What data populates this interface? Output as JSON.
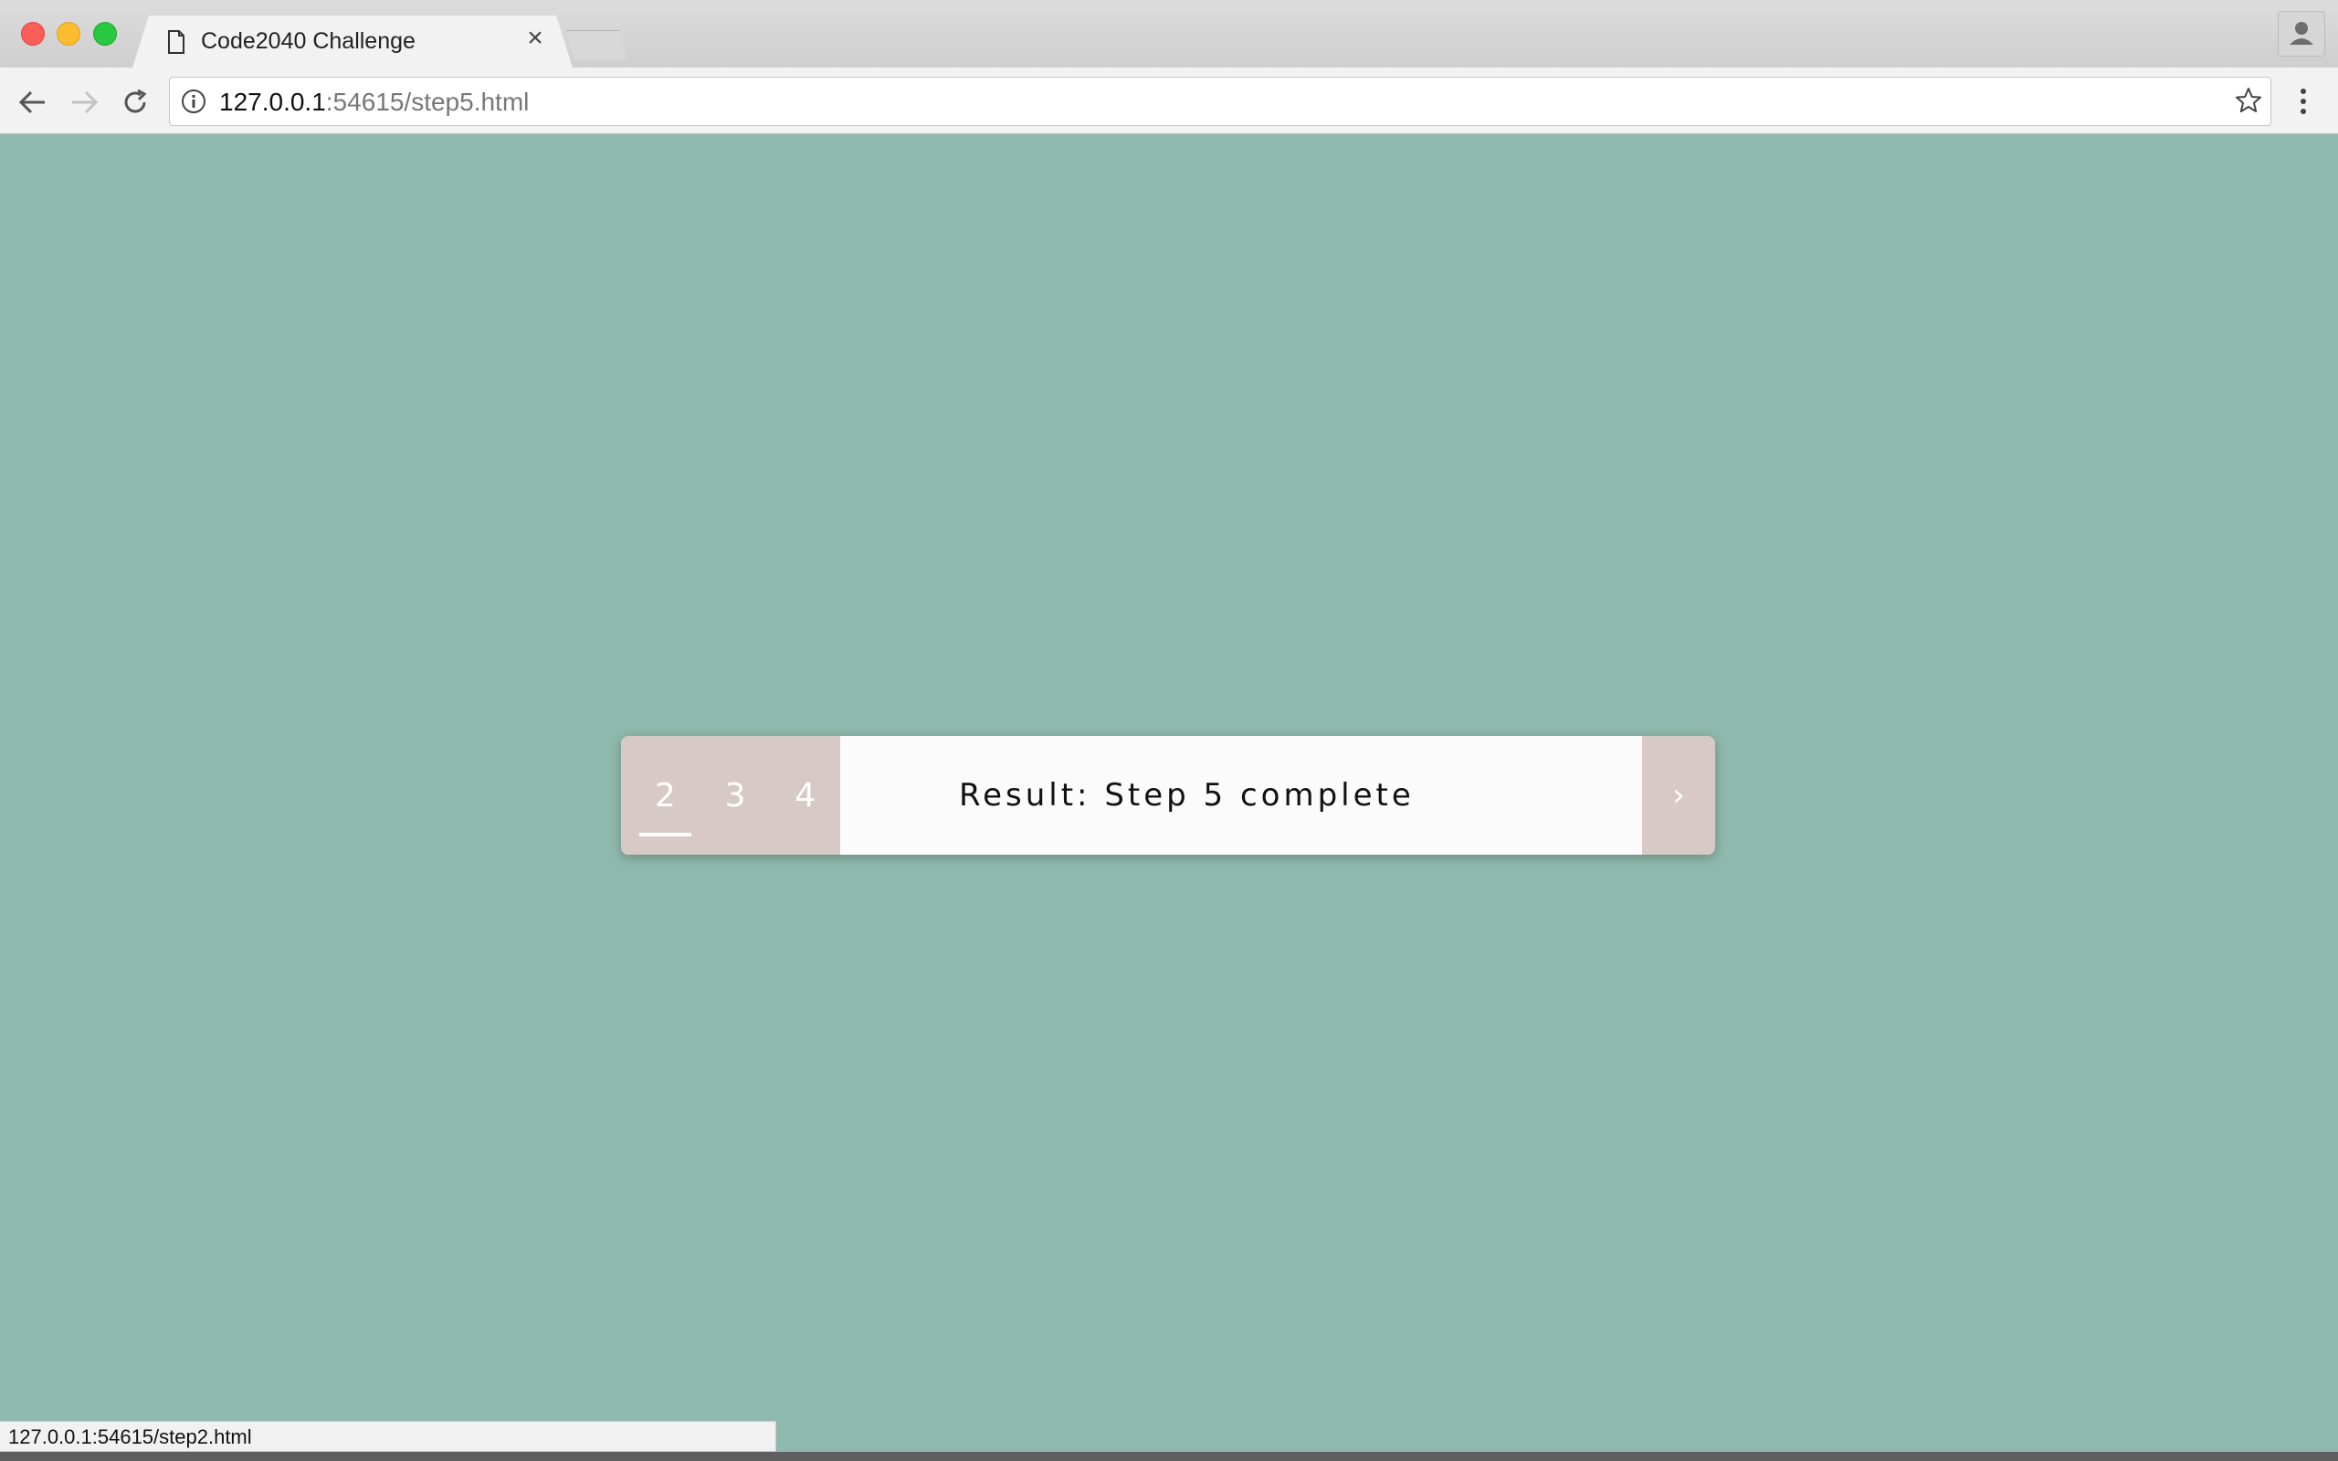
{
  "browser": {
    "tab": {
      "title": "Code2040 Challenge",
      "close_glyph": "×"
    },
    "address": {
      "host": "127.0.0.1",
      "rest": ":54615/step5.html"
    },
    "status_url": "127.0.0.1:54615/step2.html"
  },
  "widget": {
    "steps": [
      {
        "label": "2",
        "active": true
      },
      {
        "label": "3",
        "active": false
      },
      {
        "label": "4",
        "active": false
      }
    ],
    "result_text": "Result: Step 5 complete",
    "next_glyph": "›"
  },
  "colors": {
    "page_background": "#8fb9ad",
    "step_panel": "#d7c9c6",
    "result_panel": "#fbfbfb"
  },
  "icons": [
    "page-icon",
    "close-icon",
    "back-icon",
    "forward-icon",
    "reload-icon",
    "info-icon",
    "star-icon",
    "menu-icon",
    "profile-icon"
  ]
}
